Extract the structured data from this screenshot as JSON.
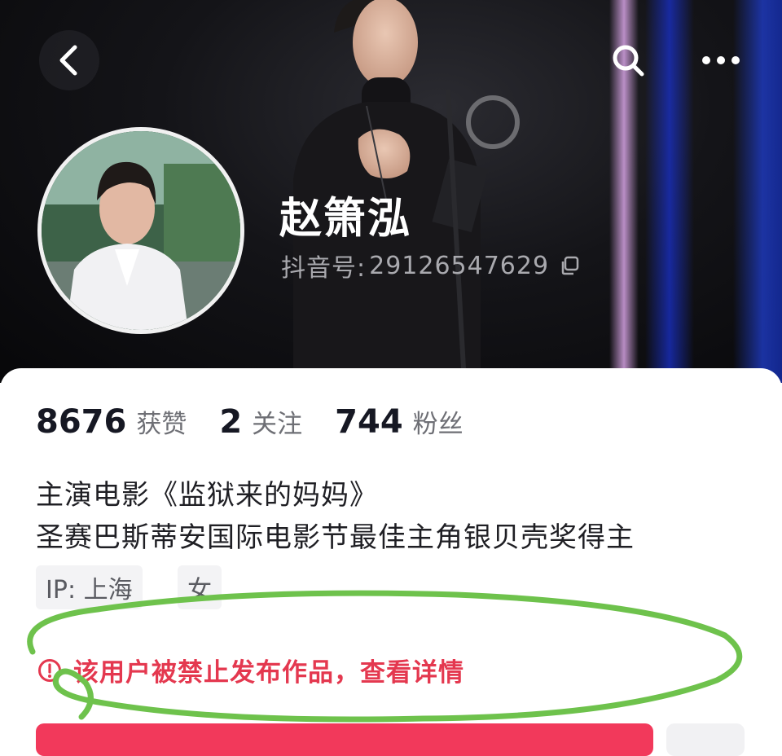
{
  "header": {
    "back_icon": "chevron-left-icon",
    "search_icon": "search-icon",
    "more_icon": "more-horizontal-icon"
  },
  "profile": {
    "name": "赵箫泓",
    "douyin_id_label": "抖音号:",
    "douyin_id": "29126547629",
    "copy_icon": "copy-icon"
  },
  "stats": [
    {
      "value": "8676",
      "label": "获赞"
    },
    {
      "value": "2",
      "label": "关注"
    },
    {
      "value": "744",
      "label": "粉丝"
    }
  ],
  "bio": [
    "主演电影《监狱来的妈妈》",
    "圣赛巴斯蒂安国际电影节最佳主角银贝壳奖得主"
  ],
  "tags": {
    "ip": "IP: 上海",
    "gender": "女"
  },
  "notice": {
    "icon": "alert-circle-icon",
    "text": "该用户被禁止发布作品，查看详情",
    "color": "#e4384f"
  },
  "colors": {
    "accent": "#f2395b",
    "highlight": "#6ec24c"
  }
}
